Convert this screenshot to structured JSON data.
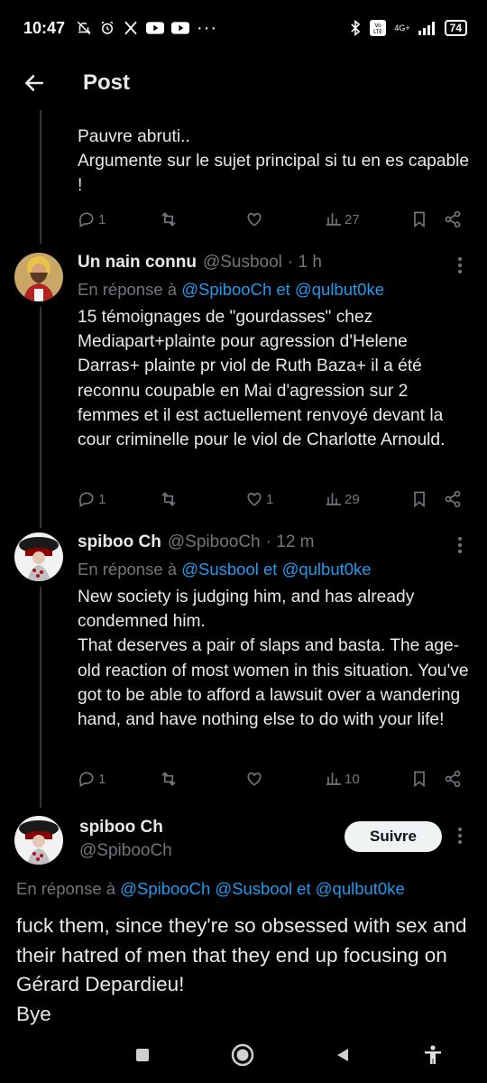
{
  "status_bar": {
    "time": "10:47",
    "battery": "74",
    "network": "4G+"
  },
  "header": {
    "title": "Post"
  },
  "tweets": [
    {
      "text": "Pauvre abruti..\nArgumente sur le sujet principal si tu en es capable !",
      "replies": "1",
      "likes": "",
      "views": "27"
    },
    {
      "name": "Un nain connu",
      "handle": "@Susbool",
      "time": "· 1 h",
      "reply_prefix": "En réponse à",
      "mention1": "@SpibooCh",
      "conj": "et",
      "mention2": "@qulbut0ke",
      "text": "15 témoignages de \"gourdasses\" chez Mediapart+plainte pour agression d'Helene Darras+ plainte pr viol de Ruth Baza+ il a été reconnu coupable en Mai d'agression sur 2 femmes et il est actuellement renvoyé devant la cour criminelle pour le viol de Charlotte Arnould.",
      "replies": "1",
      "likes": "1",
      "views": "29"
    },
    {
      "name": "spiboo Ch",
      "handle": "@SpibooCh",
      "time": "· 12 m",
      "reply_prefix": "En réponse à",
      "mention1": "@Susbool",
      "conj": "et",
      "mention2": "@qulbut0ke",
      "text": "New society is judging him, and has already condemned him.\nThat deserves a pair of slaps and basta. The age-old reaction of most women in this situation. You've got to be able to afford a lawsuit over a wandering hand, and have nothing else to do with your life!",
      "replies": "1",
      "likes": "",
      "views": "10"
    }
  ],
  "main_tweet": {
    "name": "spiboo Ch",
    "handle": "@SpibooCh",
    "follow_label": "Suivre",
    "reply_prefix": "En réponse à",
    "mention1": "@SpibooCh",
    "mention2": "@Susbool",
    "conj": "et",
    "mention3": "@qulbut0ke",
    "text": "fuck them, since they're so obsessed with sex and their hatred of men that they end up focusing on Gérard Depardieu!\nBye"
  },
  "colors": {
    "background": "#000000",
    "text": "#e7e9ea",
    "secondary": "#71767b",
    "link": "#1d9bf0"
  }
}
